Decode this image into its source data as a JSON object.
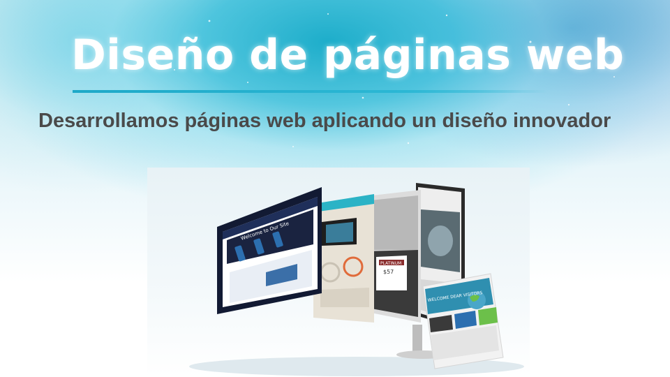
{
  "slide": {
    "title": "Diseño de páginas web",
    "subtitle": "Desarrollamos páginas web aplicando un diseño innovador",
    "accent_color": "#1ea9c8"
  },
  "hero_image": {
    "screen1_heading": "Welcome to Our Site",
    "screen3_badge": "PLATINUM",
    "screen3_price": "$57",
    "tablet_heading": "WELCOME DEAR VISITORS"
  }
}
